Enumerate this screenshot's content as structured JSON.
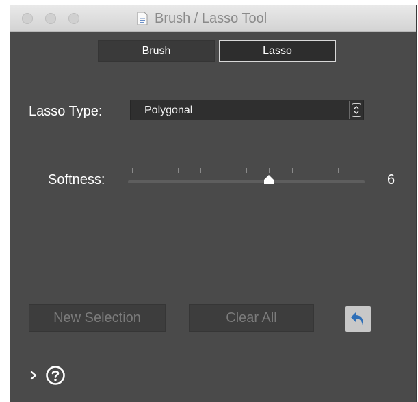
{
  "window": {
    "title": "Brush / Lasso Tool",
    "title_icon": "document-icon"
  },
  "mode_tabs": [
    {
      "label": "Brush",
      "selected": false
    },
    {
      "label": "Lasso",
      "selected": true
    }
  ],
  "lasso_type": {
    "label": "Lasso Type:",
    "value": "Polygonal"
  },
  "softness": {
    "label": "Softness:",
    "value": "6",
    "min": 0,
    "max": 10,
    "tick_count": 11
  },
  "actions": {
    "new_selection": "New Selection",
    "clear_all": "Clear All",
    "undo_icon": "undo-icon"
  },
  "footer": {
    "expand_icon": "chevron-right-icon",
    "help_icon": "help-icon"
  },
  "colors": {
    "panel_bg": "#4a4a4a",
    "undo_arrow": "#2f6fb7"
  }
}
